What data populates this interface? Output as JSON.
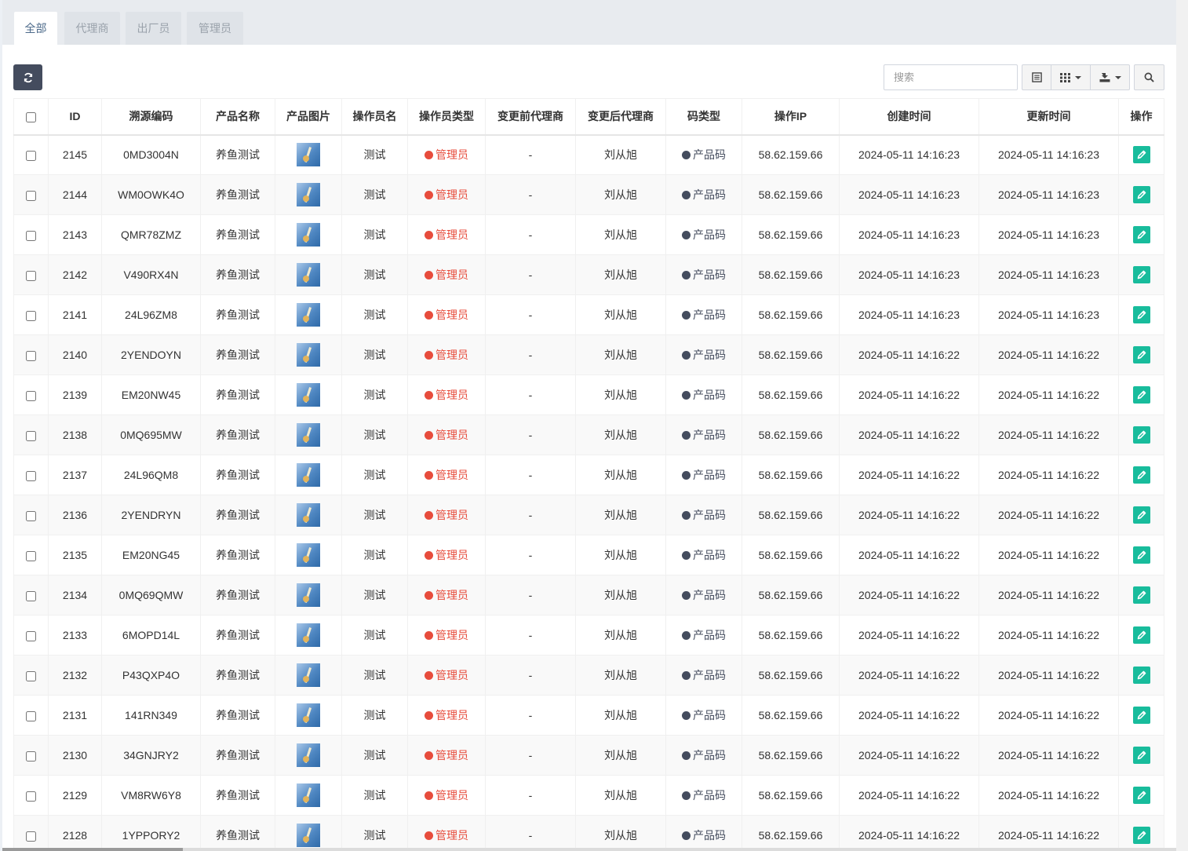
{
  "tabs": [
    {
      "label": "全部",
      "active": true
    },
    {
      "label": "代理商",
      "active": false
    },
    {
      "label": "出厂员",
      "active": false
    },
    {
      "label": "管理员",
      "active": false
    }
  ],
  "toolbar": {
    "refresh_icon": "refresh-icon",
    "search_placeholder": "搜索",
    "search_value": "",
    "toggle_view_icon": "list-view-icon",
    "columns_icon": "grid-columns-icon",
    "export_icon": "export-icon",
    "search_button_icon": "search-icon"
  },
  "colors": {
    "refresh_button": "#444c5e",
    "operator_type": "#e74c3c",
    "code_type": "#444c5e",
    "edit_button": "#18bc9c"
  },
  "table": {
    "columns": [
      "ID",
      "溯源编码",
      "产品名称",
      "产品图片",
      "操作员名",
      "操作员类型",
      "变更前代理商",
      "变更后代理商",
      "码类型",
      "操作IP",
      "创建时间",
      "更新时间",
      "操作"
    ],
    "rows": [
      {
        "id": "2145",
        "code": "0MD3004N",
        "product": "养鱼测试",
        "operator": "测试",
        "operator_type": "管理员",
        "before_agent": "-",
        "after_agent": "刘从旭",
        "code_type": "产品码",
        "ip": "58.62.159.66",
        "created": "2024-05-11 14:16:23",
        "updated": "2024-05-11 14:16:23"
      },
      {
        "id": "2144",
        "code": "WM0OWK4O",
        "product": "养鱼测试",
        "operator": "测试",
        "operator_type": "管理员",
        "before_agent": "-",
        "after_agent": "刘从旭",
        "code_type": "产品码",
        "ip": "58.62.159.66",
        "created": "2024-05-11 14:16:23",
        "updated": "2024-05-11 14:16:23"
      },
      {
        "id": "2143",
        "code": "QMR78ZMZ",
        "product": "养鱼测试",
        "operator": "测试",
        "operator_type": "管理员",
        "before_agent": "-",
        "after_agent": "刘从旭",
        "code_type": "产品码",
        "ip": "58.62.159.66",
        "created": "2024-05-11 14:16:23",
        "updated": "2024-05-11 14:16:23"
      },
      {
        "id": "2142",
        "code": "V490RX4N",
        "product": "养鱼测试",
        "operator": "测试",
        "operator_type": "管理员",
        "before_agent": "-",
        "after_agent": "刘从旭",
        "code_type": "产品码",
        "ip": "58.62.159.66",
        "created": "2024-05-11 14:16:23",
        "updated": "2024-05-11 14:16:23"
      },
      {
        "id": "2141",
        "code": "24L96ZM8",
        "product": "养鱼测试",
        "operator": "测试",
        "operator_type": "管理员",
        "before_agent": "-",
        "after_agent": "刘从旭",
        "code_type": "产品码",
        "ip": "58.62.159.66",
        "created": "2024-05-11 14:16:23",
        "updated": "2024-05-11 14:16:23"
      },
      {
        "id": "2140",
        "code": "2YENDOYN",
        "product": "养鱼测试",
        "operator": "测试",
        "operator_type": "管理员",
        "before_agent": "-",
        "after_agent": "刘从旭",
        "code_type": "产品码",
        "ip": "58.62.159.66",
        "created": "2024-05-11 14:16:22",
        "updated": "2024-05-11 14:16:22"
      },
      {
        "id": "2139",
        "code": "EM20NW45",
        "product": "养鱼测试",
        "operator": "测试",
        "operator_type": "管理员",
        "before_agent": "-",
        "after_agent": "刘从旭",
        "code_type": "产品码",
        "ip": "58.62.159.66",
        "created": "2024-05-11 14:16:22",
        "updated": "2024-05-11 14:16:22"
      },
      {
        "id": "2138",
        "code": "0MQ695MW",
        "product": "养鱼测试",
        "operator": "测试",
        "operator_type": "管理员",
        "before_agent": "-",
        "after_agent": "刘从旭",
        "code_type": "产品码",
        "ip": "58.62.159.66",
        "created": "2024-05-11 14:16:22",
        "updated": "2024-05-11 14:16:22"
      },
      {
        "id": "2137",
        "code": "24L96QM8",
        "product": "养鱼测试",
        "operator": "测试",
        "operator_type": "管理员",
        "before_agent": "-",
        "after_agent": "刘从旭",
        "code_type": "产品码",
        "ip": "58.62.159.66",
        "created": "2024-05-11 14:16:22",
        "updated": "2024-05-11 14:16:22"
      },
      {
        "id": "2136",
        "code": "2YENDRYN",
        "product": "养鱼测试",
        "operator": "测试",
        "operator_type": "管理员",
        "before_agent": "-",
        "after_agent": "刘从旭",
        "code_type": "产品码",
        "ip": "58.62.159.66",
        "created": "2024-05-11 14:16:22",
        "updated": "2024-05-11 14:16:22"
      },
      {
        "id": "2135",
        "code": "EM20NG45",
        "product": "养鱼测试",
        "operator": "测试",
        "operator_type": "管理员",
        "before_agent": "-",
        "after_agent": "刘从旭",
        "code_type": "产品码",
        "ip": "58.62.159.66",
        "created": "2024-05-11 14:16:22",
        "updated": "2024-05-11 14:16:22"
      },
      {
        "id": "2134",
        "code": "0MQ69QMW",
        "product": "养鱼测试",
        "operator": "测试",
        "operator_type": "管理员",
        "before_agent": "-",
        "after_agent": "刘从旭",
        "code_type": "产品码",
        "ip": "58.62.159.66",
        "created": "2024-05-11 14:16:22",
        "updated": "2024-05-11 14:16:22"
      },
      {
        "id": "2133",
        "code": "6MOPD14L",
        "product": "养鱼测试",
        "operator": "测试",
        "operator_type": "管理员",
        "before_agent": "-",
        "after_agent": "刘从旭",
        "code_type": "产品码",
        "ip": "58.62.159.66",
        "created": "2024-05-11 14:16:22",
        "updated": "2024-05-11 14:16:22"
      },
      {
        "id": "2132",
        "code": "P43QXP4O",
        "product": "养鱼测试",
        "operator": "测试",
        "operator_type": "管理员",
        "before_agent": "-",
        "after_agent": "刘从旭",
        "code_type": "产品码",
        "ip": "58.62.159.66",
        "created": "2024-05-11 14:16:22",
        "updated": "2024-05-11 14:16:22"
      },
      {
        "id": "2131",
        "code": "141RN349",
        "product": "养鱼测试",
        "operator": "测试",
        "operator_type": "管理员",
        "before_agent": "-",
        "after_agent": "刘从旭",
        "code_type": "产品码",
        "ip": "58.62.159.66",
        "created": "2024-05-11 14:16:22",
        "updated": "2024-05-11 14:16:22"
      },
      {
        "id": "2130",
        "code": "34GNJRY2",
        "product": "养鱼测试",
        "operator": "测试",
        "operator_type": "管理员",
        "before_agent": "-",
        "after_agent": "刘从旭",
        "code_type": "产品码",
        "ip": "58.62.159.66",
        "created": "2024-05-11 14:16:22",
        "updated": "2024-05-11 14:16:22"
      },
      {
        "id": "2129",
        "code": "VM8RW6Y8",
        "product": "养鱼测试",
        "operator": "测试",
        "operator_type": "管理员",
        "before_agent": "-",
        "after_agent": "刘从旭",
        "code_type": "产品码",
        "ip": "58.62.159.66",
        "created": "2024-05-11 14:16:22",
        "updated": "2024-05-11 14:16:22"
      },
      {
        "id": "2128",
        "code": "1YPPORY2",
        "product": "养鱼测试",
        "operator": "测试",
        "operator_type": "管理员",
        "before_agent": "-",
        "after_agent": "刘从旭",
        "code_type": "产品码",
        "ip": "58.62.159.66",
        "created": "2024-05-11 14:16:22",
        "updated": "2024-05-11 14:16:22"
      }
    ]
  }
}
